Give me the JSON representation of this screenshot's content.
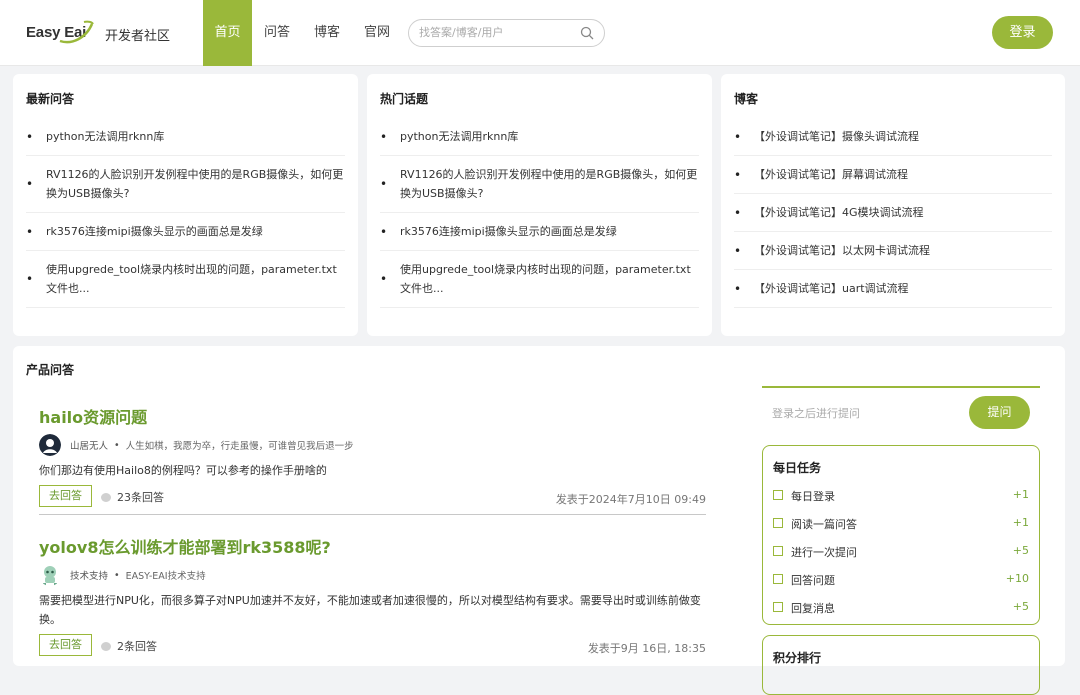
{
  "header": {
    "logo_text": "Easy Eai",
    "site_name": "开发者社区",
    "nav": [
      "首页",
      "问答",
      "博客",
      "官网"
    ],
    "search_placeholder": "找答案/博客/用户",
    "login_label": "登录",
    "accent_color": "#9ab83a"
  },
  "latest": {
    "title": "最新问答",
    "items": [
      "python无法调用rknn库",
      "RV1126的人脸识别开发例程中使用的是RGB摄像头，如何更换为USB摄像头?",
      "rk3576连接mipi摄像头显示的画面总是发绿",
      "使用upgrede_tool烧录内核时出现的问题，parameter.txt文件也..."
    ]
  },
  "hot": {
    "title": "热门话题",
    "items": [
      "python无法调用rknn库",
      "RV1126的人脸识别开发例程中使用的是RGB摄像头，如何更换为USB摄像头?",
      "rk3576连接mipi摄像头显示的画面总是发绿",
      "使用upgrede_tool烧录内核时出现的问题，parameter.txt文件也..."
    ]
  },
  "blog": {
    "title": "博客",
    "items": [
      "【外设调试笔记】摄像头调试流程",
      "【外设调试笔记】屏幕调试流程",
      "【外设调试笔记】4G模块调试流程",
      "【外设调试笔记】以太网卡调试流程",
      "【外设调试笔记】uart调试流程"
    ]
  },
  "products": {
    "title": "产品问答",
    "questions": [
      {
        "title": "hailo资源问题",
        "author": "山居无人",
        "signature": "人生如棋，我愿为卒，行走虽慢，可谁曾见我后退一步",
        "body": "你们那边有使用Hailo8的例程吗？可以参考的操作手册啥的",
        "answer_btn": "去回答",
        "answers": "23条回答",
        "date": "发表于2024年7月10日 09:49"
      },
      {
        "title": "yolov8怎么训练才能部署到rk3588呢?",
        "author": "技术支持",
        "signature": "EASY-EAI技术支持",
        "body": "需要把模型进行NPU化，而很多算子对NPU加速并不友好，不能加速或者加速很慢的，所以对模型结构有要求。需要导出时或训练前做变换。",
        "answer_btn": "去回答",
        "answers": "2条回答",
        "date": "发表于9月 16日, 18:35"
      }
    ]
  },
  "sidebar": {
    "ask_hint": "登录之后进行提问",
    "ask_label": "提问",
    "tasks_title": "每日任务",
    "tasks": [
      {
        "label": "每日登录",
        "points": "+1"
      },
      {
        "label": "阅读一篇问答",
        "points": "+1"
      },
      {
        "label": "进行一次提问",
        "points": "+5"
      },
      {
        "label": "回答问题",
        "points": "+10"
      },
      {
        "label": "回复消息",
        "points": "+5"
      }
    ],
    "rank_title": "积分排行"
  }
}
